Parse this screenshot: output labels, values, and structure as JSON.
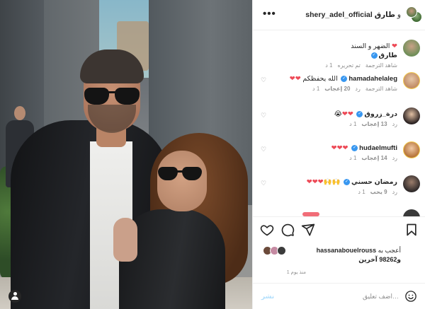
{
  "post": {
    "author": "shery_adel_official",
    "coauthor_conjunction": "و",
    "coauthor": "طارق",
    "more_icon": "more-horizontal-icon"
  },
  "caption": {
    "username": "طارق",
    "text": "الضهر و السند",
    "hearts": "❤",
    "time": "1 د",
    "see_translation": "شاهد الترجمة",
    "edited": "تم تحريره"
  },
  "comments": [
    {
      "username": "hamadahelaleg",
      "text": "الله يحفظكم",
      "hearts": "❤❤",
      "time": "1 د",
      "likes": "20 إعجاب",
      "reply": "رد",
      "see_translation": "شاهد الترجمة"
    },
    {
      "username": "درة_زروق",
      "text": "",
      "hearts": "❤❤",
      "emoji": "😭",
      "time": "1 د",
      "likes": "13 إعجاب",
      "reply": "رد"
    },
    {
      "username": "hudaelmufti",
      "text": "",
      "hearts": "❤❤❤",
      "time": "1 د",
      "likes": "14 إعجاب",
      "reply": "رد"
    },
    {
      "username": "رمضان حسني",
      "text": "",
      "hearts": "❤❤❤",
      "emoji": "🙌🙌",
      "time": "1 د",
      "likes": "9 يحب",
      "reply": "رد"
    }
  ],
  "actions": {
    "like_icon": "heart-icon",
    "comment_icon": "comment-icon",
    "share_icon": "paper-plane-icon",
    "save_icon": "bookmark-icon"
  },
  "likes": {
    "prefix": "أعجب به",
    "user": "hassanabouelrouss",
    "others": "و98262 آخرين"
  },
  "timestamp": "منذ يوم 1",
  "add_comment": {
    "placeholder": "اضف تعليق…",
    "post_label": "نشر",
    "emoji_icon": "smiley-icon"
  },
  "colors": {
    "heart_red": "#ed4956",
    "verified_blue": "#3897f0",
    "post_button": "#b2dffc",
    "muted_text": "#8e8e8e"
  }
}
